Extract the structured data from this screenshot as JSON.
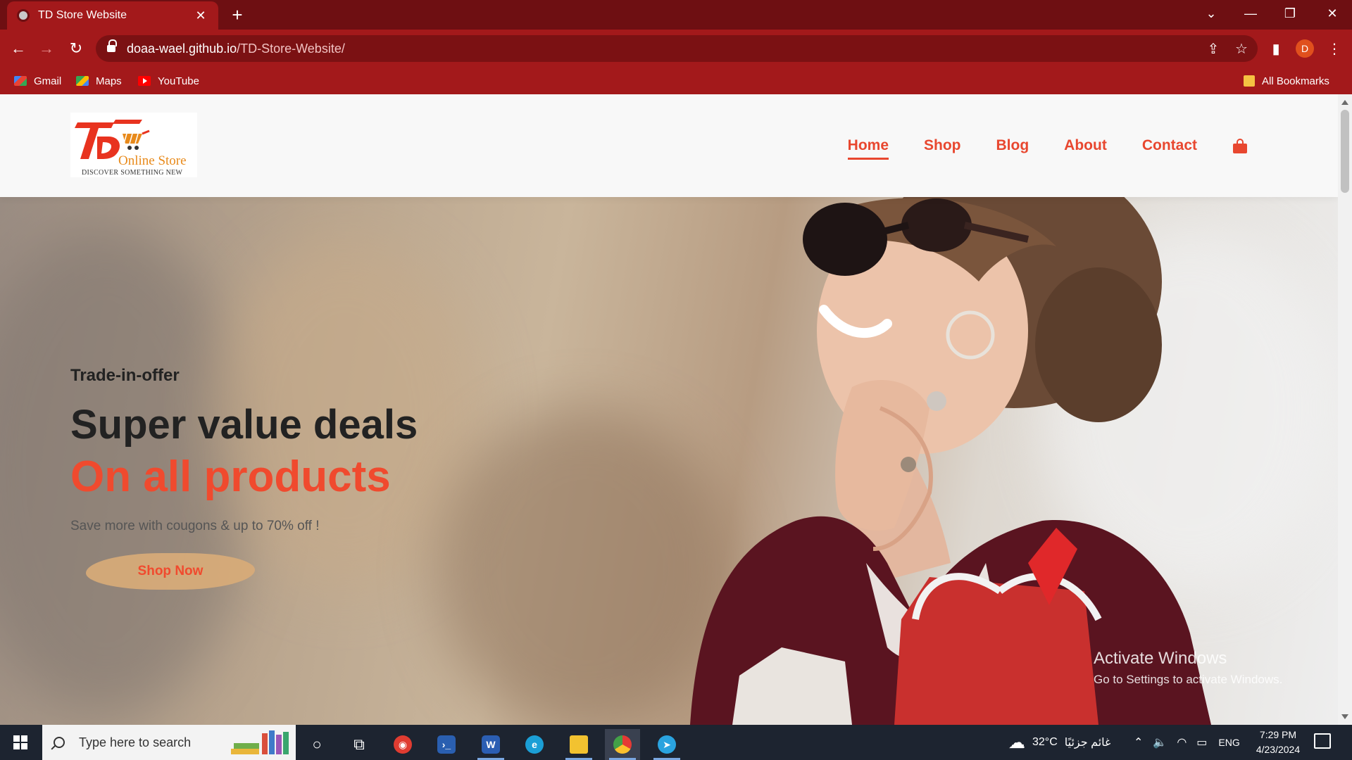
{
  "browser": {
    "tab_title": "TD Store Website",
    "new_tab_symbol": "+",
    "url_host": "doaa-wael.github.io",
    "url_path": "/TD-Store-Website/",
    "profile_initial": "D",
    "bookmarks": [
      "Gmail",
      "Maps",
      "YouTube"
    ],
    "all_bookmarks": "All Bookmarks"
  },
  "site": {
    "logo": {
      "brand": "Online Store",
      "tagline": "DISCOVER SOMETHING NEW"
    },
    "nav": [
      "Home",
      "Shop",
      "Blog",
      "About",
      "Contact"
    ],
    "active_nav": "Home",
    "hero": {
      "eyebrow": "Trade-in-offer",
      "headline": "Super value deals",
      "highlight": "On all products",
      "subtext": "Save more with cougons & up to 70% off !",
      "cta": "Shop Now"
    }
  },
  "overlay": {
    "activate_title": "Activate Windows",
    "activate_sub": "Go to Settings to activate Windows."
  },
  "taskbar": {
    "search_placeholder": "Type here to search",
    "weather_temp": "32°C",
    "weather_desc": "غائم جزئيًا",
    "language": "ENG",
    "time": "7:29 PM",
    "date": "4/23/2024"
  },
  "colors": {
    "accent": "#e8472f",
    "tab_bar": "#6e0f12",
    "toolbar": "#a3191b"
  }
}
